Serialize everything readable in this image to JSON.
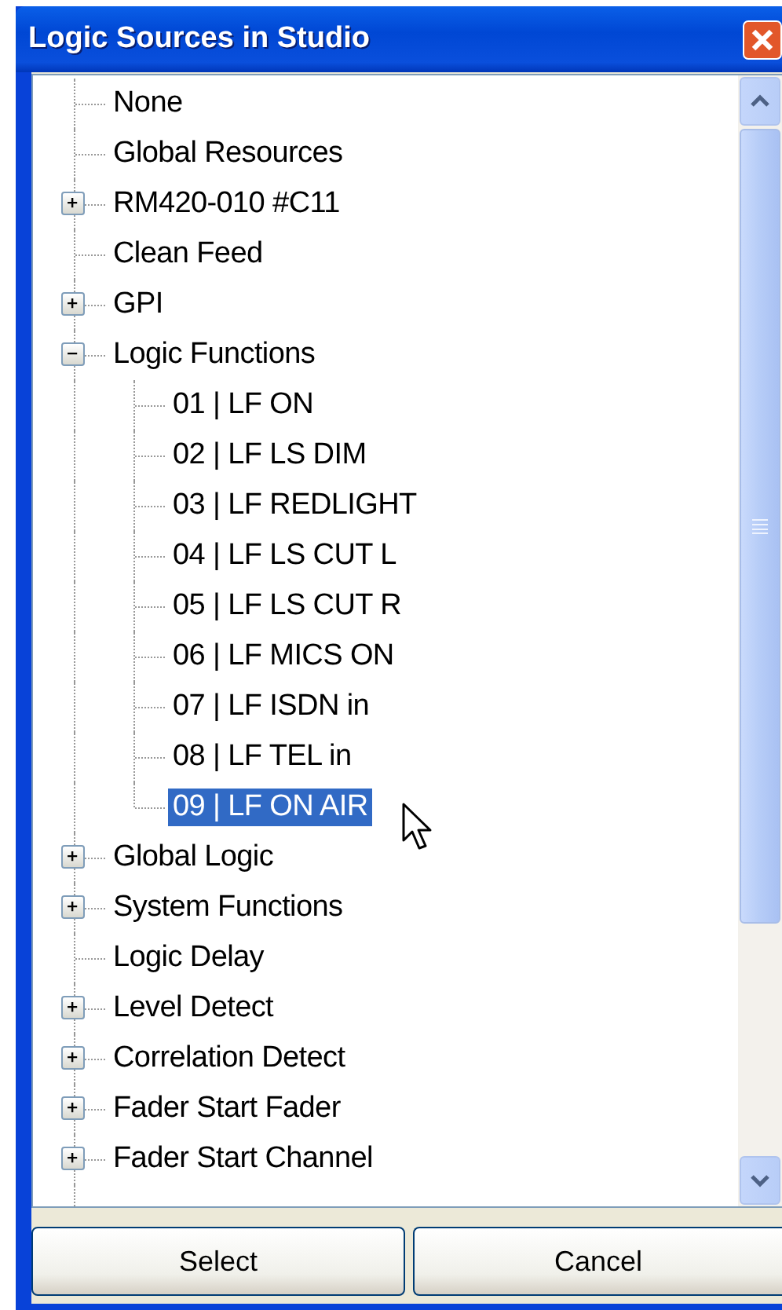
{
  "window": {
    "title": "Logic Sources in Studio"
  },
  "tree": [
    {
      "label": "None",
      "selected": false
    },
    {
      "label": "Global Resources",
      "selected": false
    },
    {
      "label": "RM420-010 #C11",
      "selected": false,
      "expanded": false
    },
    {
      "label": "Clean Feed",
      "selected": false
    },
    {
      "label": "GPI",
      "selected": false,
      "expanded": false
    },
    {
      "label": "Logic Functions",
      "selected": false,
      "expanded": true,
      "children": [
        {
          "label": "01 | LF ON",
          "selected": false
        },
        {
          "label": "02 | LF LS DIM",
          "selected": false
        },
        {
          "label": "03 | LF REDLIGHT",
          "selected": false
        },
        {
          "label": "04 | LF LS CUT L",
          "selected": false
        },
        {
          "label": "05 | LF LS CUT R",
          "selected": false
        },
        {
          "label": "06 | LF MICS ON",
          "selected": false
        },
        {
          "label": "07 | LF ISDN in",
          "selected": false
        },
        {
          "label": "08 | LF TEL in",
          "selected": false
        },
        {
          "label": "09 | LF ON AIR",
          "selected": true
        }
      ]
    },
    {
      "label": "Global Logic",
      "selected": false,
      "expanded": false
    },
    {
      "label": "System Functions",
      "selected": false,
      "expanded": false
    },
    {
      "label": "Logic Delay",
      "selected": false
    },
    {
      "label": "Level Detect",
      "selected": false,
      "expanded": false
    },
    {
      "label": "Correlation Detect",
      "selected": false,
      "expanded": false
    },
    {
      "label": "Fader Start Fader",
      "selected": false,
      "expanded": false
    },
    {
      "label": "Fader Start Channel",
      "selected": false,
      "expanded": false
    }
  ],
  "buttons": [
    "Select",
    "Cancel"
  ]
}
